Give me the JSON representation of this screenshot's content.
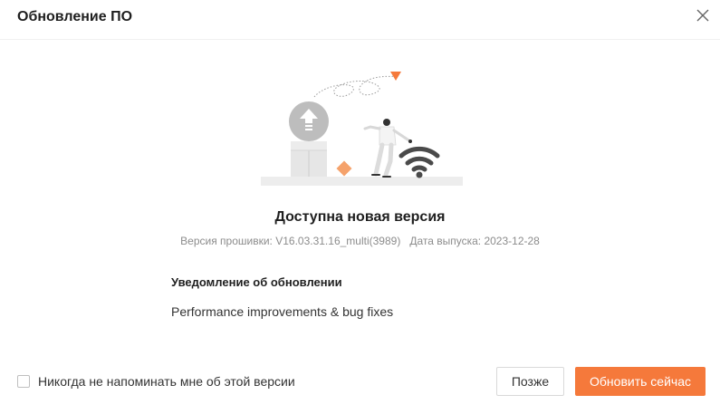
{
  "dialog": {
    "title": "Обновление ПО",
    "close_icon": "close-icon"
  },
  "illustration": {
    "icons": [
      "upload-arrow-icon",
      "wifi-icon",
      "person-figure",
      "box-icon",
      "diamond-icon",
      "triangle-marker-icon"
    ],
    "accent_color": "#f5793b"
  },
  "update": {
    "headline": "Доступна новая версия",
    "firmware_label": "Версия прошивки:",
    "firmware_value": "V16.03.31.16_multi(3989)",
    "release_label": "Дата выпуска:",
    "release_value": "2023-12-28"
  },
  "notes": {
    "title": "Уведомление об обновлении",
    "body": "Performance improvements & bug fixes"
  },
  "footer": {
    "never_remind_label": "Никогда не напоминать мне об этой версии",
    "never_remind_checked": false,
    "later_label": "Позже",
    "update_now_label": "Обновить сейчас"
  },
  "colors": {
    "primary": "#f5793b",
    "text": "#1f1f1f",
    "muted": "#8c8c8c"
  }
}
